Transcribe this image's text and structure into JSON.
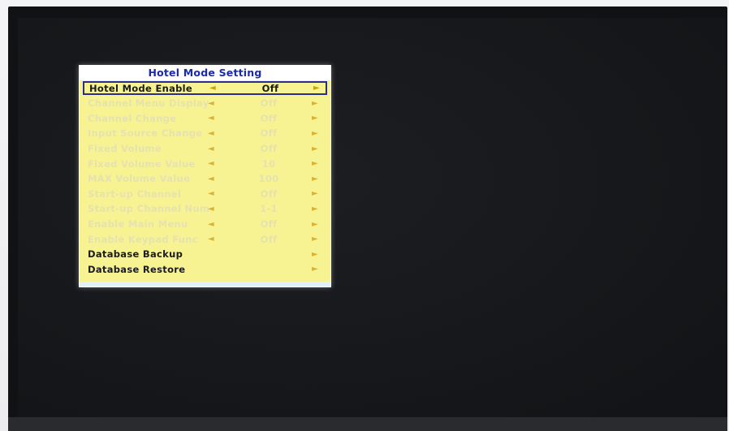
{
  "menu": {
    "title": "Hotel Mode Setting",
    "arrow_left": "◄",
    "arrow_right": "►",
    "items": [
      {
        "label": "Hotel Mode Enable",
        "value": "Off",
        "state": "selected"
      },
      {
        "label": "Channel Menu Display",
        "value": "Off",
        "state": "disabled"
      },
      {
        "label": "Channel Change",
        "value": "Off",
        "state": "disabled"
      },
      {
        "label": "Input Source Change",
        "value": "Off",
        "state": "disabled"
      },
      {
        "label": "Fixed Volume",
        "value": "Off",
        "state": "disabled"
      },
      {
        "label": "Fixed Volume Value",
        "value": "10",
        "state": "disabled"
      },
      {
        "label": "MAX Volume Value",
        "value": "100",
        "state": "disabled"
      },
      {
        "label": "Start-up Channel",
        "value": "Off",
        "state": "disabled"
      },
      {
        "label": "Start-up Channel Num",
        "value": "1-1",
        "state": "disabled"
      },
      {
        "label": "Enable Main Menu",
        "value": "Off",
        "state": "disabled"
      },
      {
        "label": "Enable Keypad Func",
        "value": "Off",
        "state": "disabled"
      },
      {
        "label": "Database Backup",
        "value": "",
        "state": "action"
      },
      {
        "label": "Database Restore",
        "value": "",
        "state": "action"
      }
    ]
  }
}
